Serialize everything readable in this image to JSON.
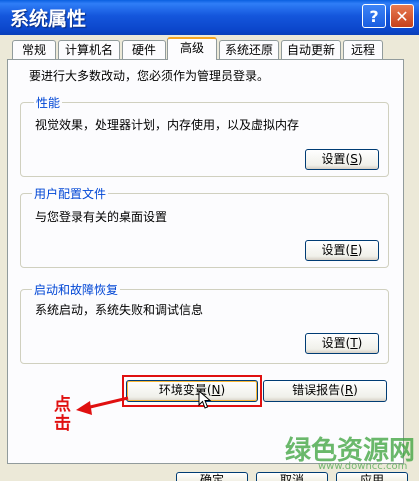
{
  "window": {
    "title": "系统属性",
    "help_glyph": "?",
    "close_glyph": "✕"
  },
  "tabs": [
    {
      "label": "常规"
    },
    {
      "label": "计算机名"
    },
    {
      "label": "硬件"
    },
    {
      "label": "高级",
      "active": true
    },
    {
      "label": "系统还原"
    },
    {
      "label": "自动更新"
    },
    {
      "label": "远程"
    }
  ],
  "main": {
    "intro": "要进行大多数改动，您必须作为管理员登录。",
    "performance": {
      "title": "性能",
      "desc": "视觉效果，处理器计划，内存使用，以及虚拟内存",
      "button": "设置",
      "key": "S"
    },
    "profile": {
      "title": "用户配置文件",
      "desc": "与您登录有关的桌面设置",
      "button": "设置",
      "key": "E"
    },
    "startup": {
      "title": "启动和故障恢复",
      "desc": "系统启动，系统失败和调试信息",
      "button": "设置",
      "key": "T"
    },
    "env_button": {
      "label": "环境变量",
      "key": "N"
    },
    "error_button": {
      "label": "错误报告",
      "key": "R"
    }
  },
  "annotation": {
    "text": "点击",
    "color": "#e01010"
  },
  "footer": {
    "ok": "确定",
    "cancel": "取消",
    "apply": "应用"
  },
  "watermark": {
    "text": "绿色资源网",
    "url": "www.downcc.com"
  },
  "colors": {
    "titlebar": "#0b46cb",
    "group_label": "#0046d5",
    "highlight": "#e01010",
    "panel": "#fcfcfe"
  }
}
